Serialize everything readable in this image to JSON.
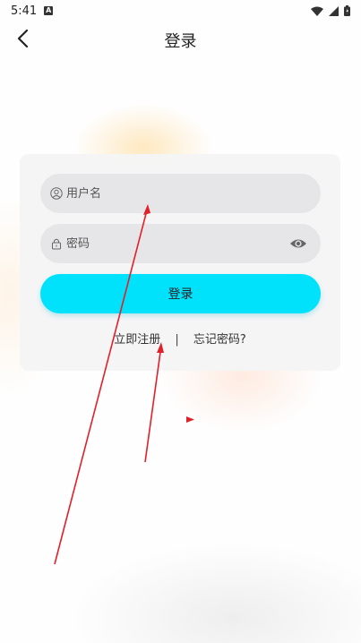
{
  "status": {
    "time": "5:41",
    "notification_badge": "A"
  },
  "header": {
    "title": "登录"
  },
  "form": {
    "username_placeholder": "用户名",
    "password_placeholder": "密码",
    "login_label": "登录",
    "register_label": "立即注册",
    "separator": "|",
    "forgot_label": "忘记密码?"
  },
  "colors": {
    "primary_button": "#00e1fb",
    "annotation_arrow": "#e0202a"
  },
  "icons": {
    "back": "chevron-left-icon",
    "user": "user-icon",
    "lock": "lock-icon",
    "visibility": "eye-icon",
    "wifi": "wifi-icon",
    "signal": "signal-icon",
    "battery": "battery-icon"
  }
}
